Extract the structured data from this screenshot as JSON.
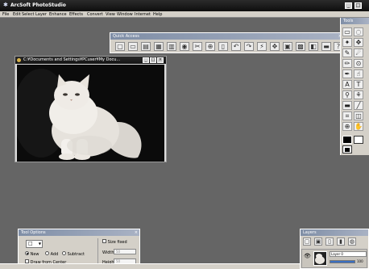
{
  "app": {
    "title": "ArcSoft PhotoStudio",
    "window_buttons": [
      "_",
      "□",
      "×"
    ]
  },
  "menu": [
    "File",
    "Edit",
    "Select",
    "Layer",
    "Enhance",
    "Effects",
    "Convert",
    "View",
    "Window",
    "Internet",
    "Help"
  ],
  "quick_access": {
    "title": "Quick Access",
    "close": "×",
    "tools": [
      "new-icon",
      "open-icon",
      "save-icon",
      "scan-icon",
      "print-icon",
      "email-icon",
      "cut-icon",
      "copy-icon",
      "paste-icon",
      "undo-icon",
      "redo-icon",
      "wand-icon",
      "resize-icon",
      "slideshow-icon",
      "gallery-icon",
      "web-icon",
      "help-icon"
    ]
  },
  "document": {
    "title": "C:¥Documents and Settings¥PCuser¥My Docu...",
    "buttons": [
      "_",
      "□",
      "×"
    ]
  },
  "tools_panel": {
    "title": "Tools"
  },
  "tool_options": {
    "title": "Tool Options",
    "close": "×",
    "shape": "□",
    "radios": [
      {
        "label": "New",
        "on": true
      },
      {
        "label": "Add",
        "on": false
      },
      {
        "label": "Subtract",
        "on": false
      }
    ],
    "draw_from_center": "Draw from Center",
    "size_fixed": "Size fixed",
    "width_label": "Width:",
    "width_value": "50",
    "height_label": "Height:",
    "height_value": "50"
  },
  "layers": {
    "title": "Layers",
    "layer_name": "Layer 0",
    "opacity": "100",
    "opacity_fraction": 1.0
  }
}
